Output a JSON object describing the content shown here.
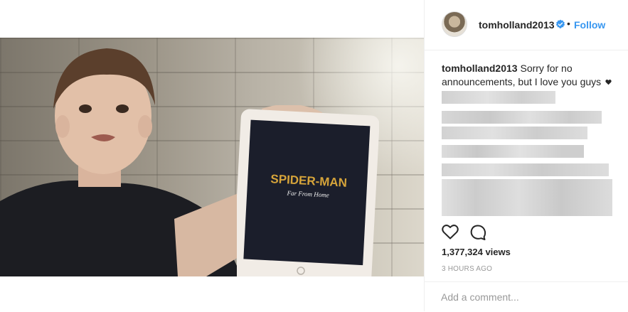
{
  "post": {
    "username": "tomholland2013",
    "follow_label": "Follow",
    "separator": "•",
    "caption_username": "tomholland2013",
    "caption_text": "Sorry for no announcements, but I love you guys",
    "views": "1,377,324 views",
    "time_ago": "3 HOURS AGO",
    "comment_placeholder": "Add a comment..."
  },
  "media": {
    "tablet_title": "SPIDER-MAN",
    "tablet_subtitle": "Far From Home"
  },
  "icons": {
    "verified": "verified-badge-icon",
    "like": "heart-outline-icon",
    "comment": "speech-bubble-icon"
  },
  "colors": {
    "accent": "#3897f0",
    "text": "#262626",
    "muted": "#999999",
    "title_gold": "#d6a43a"
  }
}
